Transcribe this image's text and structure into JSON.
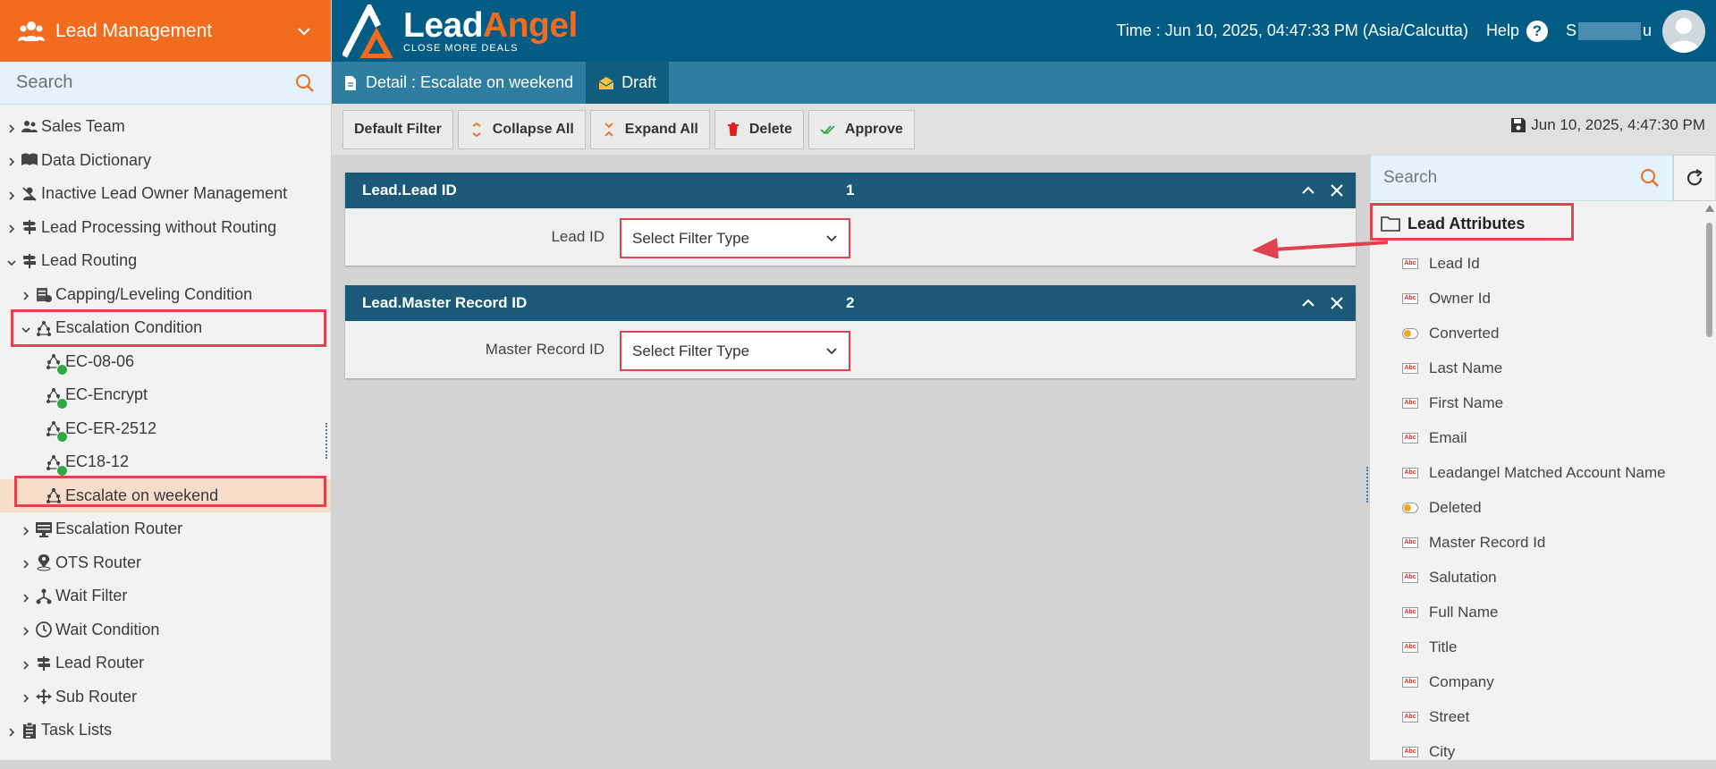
{
  "sidebar": {
    "module_title": "Lead Management",
    "search_placeholder": "Search",
    "tree": [
      {
        "label": "Sales Team",
        "icon": "users-icon",
        "level": 0,
        "expanded": false
      },
      {
        "label": "Data Dictionary",
        "icon": "book-icon",
        "level": 0,
        "expanded": false
      },
      {
        "label": "Inactive Lead Owner Management",
        "icon": "user-off-icon",
        "level": 0,
        "expanded": false
      },
      {
        "label": "Lead Processing without Routing",
        "icon": "processing-icon",
        "level": 0,
        "expanded": false
      },
      {
        "label": "Lead Routing",
        "icon": "signpost-icon",
        "level": 0,
        "expanded": true
      },
      {
        "label": "Capping/Leveling Condition",
        "icon": "capping-icon",
        "level": 1,
        "expanded": false
      },
      {
        "label": "Escalation Condition",
        "icon": "escalation-icon",
        "level": 1,
        "expanded": true,
        "highlighted": true
      },
      {
        "label": "EC-08-06",
        "icon": "escalation-approved-icon",
        "level": 2
      },
      {
        "label": "EC-Encrypt",
        "icon": "escalation-approved-icon",
        "level": 2
      },
      {
        "label": "EC-ER-2512",
        "icon": "escalation-approved-icon",
        "level": 2
      },
      {
        "label": "EC18-12",
        "icon": "escalation-approved-icon",
        "level": 2
      },
      {
        "label": "Escalate on weekend",
        "icon": "escalation-icon",
        "level": 2,
        "selected": true,
        "highlighted": true
      },
      {
        "label": "Escalation Router",
        "icon": "router-icon",
        "level": 1,
        "expanded": false
      },
      {
        "label": "OTS Router",
        "icon": "location-router-icon",
        "level": 1,
        "expanded": false
      },
      {
        "label": "Wait Filter",
        "icon": "filter-icon",
        "level": 1,
        "expanded": false
      },
      {
        "label": "Wait Condition",
        "icon": "clock-icon",
        "level": 1,
        "expanded": false
      },
      {
        "label": "Lead Router",
        "icon": "signpost-icon",
        "level": 1,
        "expanded": false
      },
      {
        "label": "Sub Router",
        "icon": "sub-router-icon",
        "level": 1,
        "expanded": false
      },
      {
        "label": "Task Lists",
        "icon": "clipboard-icon",
        "level": 0,
        "expanded": false
      }
    ]
  },
  "topbar": {
    "brand_part1": "Lead",
    "brand_part2": "Angel",
    "tagline": "CLOSE MORE DEALS",
    "time_text": "Time : Jun 10, 2025, 04:47:33 PM (Asia/Calcutta)",
    "help_label": "Help",
    "user_first": "S",
    "user_last": "u"
  },
  "tabs": {
    "detail_label": "Detail : Escalate on weekend",
    "draft_label": "Draft"
  },
  "toolbar": {
    "default_filter": "Default Filter",
    "collapse_all": "Collapse All",
    "expand_all": "Expand All",
    "delete": "Delete",
    "approve": "Approve",
    "saved_time": "Jun 10, 2025, 4:47:30 PM"
  },
  "panels": [
    {
      "title": "Lead.Lead ID",
      "number": "1",
      "field_label": "Lead ID",
      "select_value": "Select Filter Type"
    },
    {
      "title": "Lead.Master Record ID",
      "number": "2",
      "field_label": "Master Record ID",
      "select_value": "Select Filter Type"
    }
  ],
  "right_panel": {
    "search_placeholder": "Search",
    "root_label": "Lead Attributes",
    "attributes": [
      {
        "label": "Lead Id",
        "type": "text"
      },
      {
        "label": "Owner Id",
        "type": "text"
      },
      {
        "label": "Converted",
        "type": "boolean"
      },
      {
        "label": "Last Name",
        "type": "text"
      },
      {
        "label": "First Name",
        "type": "text"
      },
      {
        "label": "Email",
        "type": "text"
      },
      {
        "label": "Leadangel Matched Account Name",
        "type": "text"
      },
      {
        "label": "Deleted",
        "type": "boolean"
      },
      {
        "label": "Master Record Id",
        "type": "text"
      },
      {
        "label": "Salutation",
        "type": "text"
      },
      {
        "label": "Full Name",
        "type": "text"
      },
      {
        "label": "Title",
        "type": "text"
      },
      {
        "label": "Company",
        "type": "text"
      },
      {
        "label": "Street",
        "type": "text"
      },
      {
        "label": "City",
        "type": "text"
      }
    ]
  },
  "colors": {
    "brand_orange": "#f26c1f",
    "header_blue": "#035c83",
    "panel_header": "#1a5a78",
    "highlight_red": "#e0424f"
  }
}
